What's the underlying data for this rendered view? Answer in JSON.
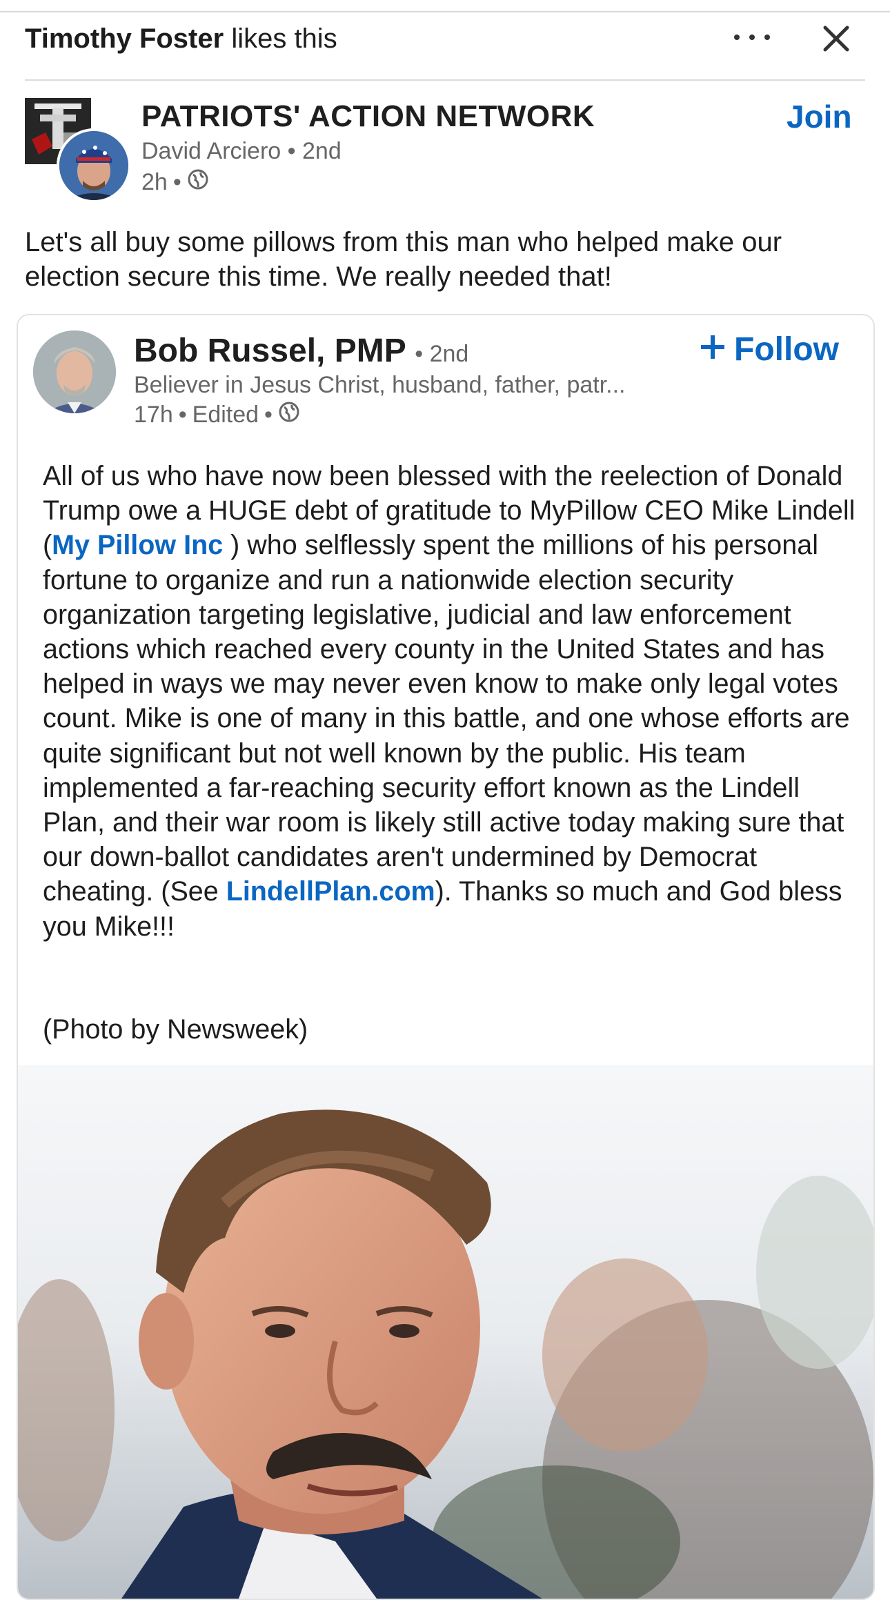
{
  "context": {
    "actor": "Timothy Foster",
    "action": "likes this"
  },
  "group": {
    "name": "PATRIOTS' ACTION NETWORK",
    "author": "David Arciero",
    "degree": "2nd",
    "time": "2h",
    "join_label": "Join"
  },
  "post": {
    "text": "Let's all buy some pillows from this man who helped make our election secure this time. We really needed that!"
  },
  "reshared": {
    "author": "Bob Russel, PMP",
    "degree": "2nd",
    "headline": "Believer in Jesus Christ, husband, father, patr...",
    "time": "17h",
    "edited": "Edited",
    "follow_label": "Follow",
    "text_part1": "All of us who have now been blessed with the reelection of Donald Trump owe a HUGE debt of gratitude to MyPillow CEO Mike Lindell (",
    "mention": "My Pillow Inc",
    "text_part2": " ) who selflessly spent the millions of his personal fortune to organize and run a nationwide election security organization targeting legislative, judicial and law enforcement actions which reached every county in the United States and has helped in ways we may never even know to make only legal votes count.  Mike is one of many in this battle, and one whose efforts are quite significant but not well known by the public. His team implemented a far-reaching security effort known as the Lindell Plan, and their war room is likely still active today making sure that our down-ballot candidates aren't undermined by Democrat cheating.  (See ",
    "link": "LindellPlan.com",
    "text_part3": "). Thanks so much and God bless you Mike!!!",
    "photo_credit": "(Photo by Newsweek)"
  },
  "colors": {
    "accent": "#0a66c2",
    "muted": "#666666",
    "text": "#1d1d1d"
  },
  "icons": {
    "more": "more-horizontal-icon",
    "close": "close-icon",
    "visibility": "globe-icon",
    "follow": "plus-icon"
  }
}
